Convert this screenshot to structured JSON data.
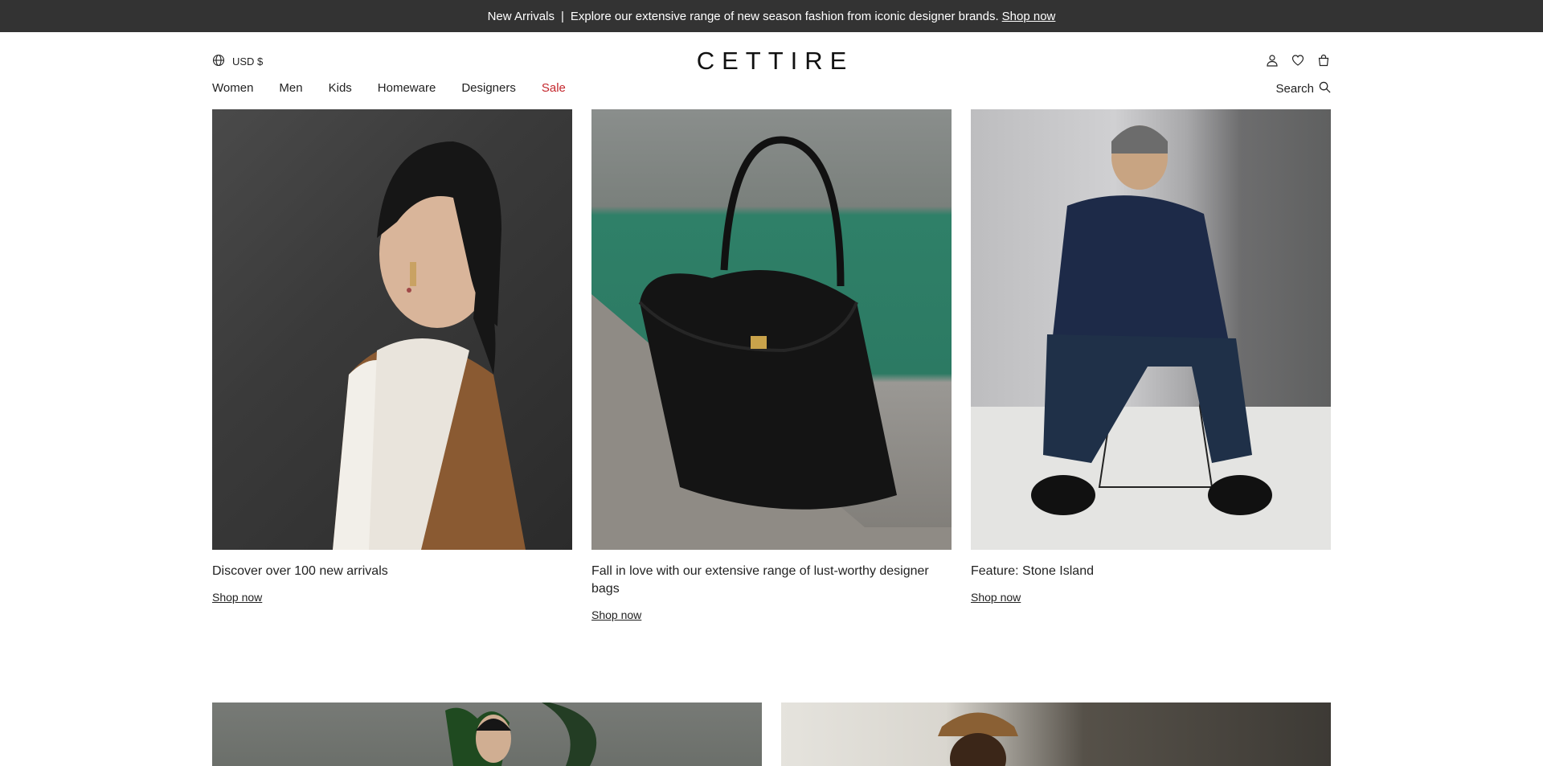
{
  "promo": {
    "text_prefix": "New Arrivals",
    "separator": "|",
    "text_body": "Explore our extensive range of new season fashion from iconic designer brands.",
    "link": "Shop now"
  },
  "header": {
    "currency": "USD $",
    "logo": "CETTIRE",
    "search_label": "Search",
    "icons": [
      "account-icon",
      "wishlist-heart-icon",
      "bag-icon",
      "globe-icon",
      "search-icon"
    ]
  },
  "nav": {
    "items": [
      {
        "label": "Women"
      },
      {
        "label": "Men"
      },
      {
        "label": "Kids"
      },
      {
        "label": "Homeware"
      },
      {
        "label": "Designers"
      },
      {
        "label": "Sale",
        "color": "#c4272d"
      }
    ]
  },
  "tiles": [
    {
      "caption": "Discover over 100 new arrivals",
      "cta": "Shop now"
    },
    {
      "caption": "Fall in love with our extensive range of lust-worthy designer bags",
      "cta": "Shop now"
    },
    {
      "caption": "Feature: Stone Island",
      "cta": "Shop now"
    }
  ],
  "colors": {
    "promo_bg": "#333333",
    "sale": "#c4272d",
    "text": "#222222"
  }
}
